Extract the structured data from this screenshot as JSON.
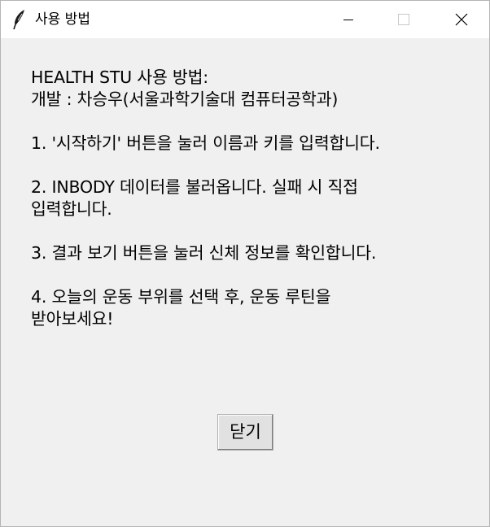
{
  "window": {
    "title": "사용 방법",
    "icon": "feather-icon",
    "controls": {
      "minimize_icon": "minimize-icon",
      "maximize_icon": "maximize-icon",
      "close_icon": "close-icon"
    }
  },
  "instructions": {
    "heading": "HEALTH STU 사용 방법:",
    "developer": "개발 : 차승우(서울과학기술대 컴퓨터공학과)",
    "step1": "1. '시작하기' 버튼을 눌러 이름과 키를 입력합니다.",
    "step2_line1": "2. INBODY 데이터를 불러옵니다. 실패 시 직접",
    "step2_line2": "입력합니다.",
    "step3": "3. 결과 보기 버튼을 눌러 신체 정보를 확인합니다.",
    "step4_line1": "4. 오늘의 운동 부위를 선택 후, 운동 루틴을",
    "step4_line2": "받아보세요!"
  },
  "buttons": {
    "close_label": "닫기"
  },
  "colors": {
    "titlebar_bg": "#ffffff",
    "window_bg": "#f0f0f0",
    "button_bg": "#e1e1e1",
    "text": "#000000"
  }
}
